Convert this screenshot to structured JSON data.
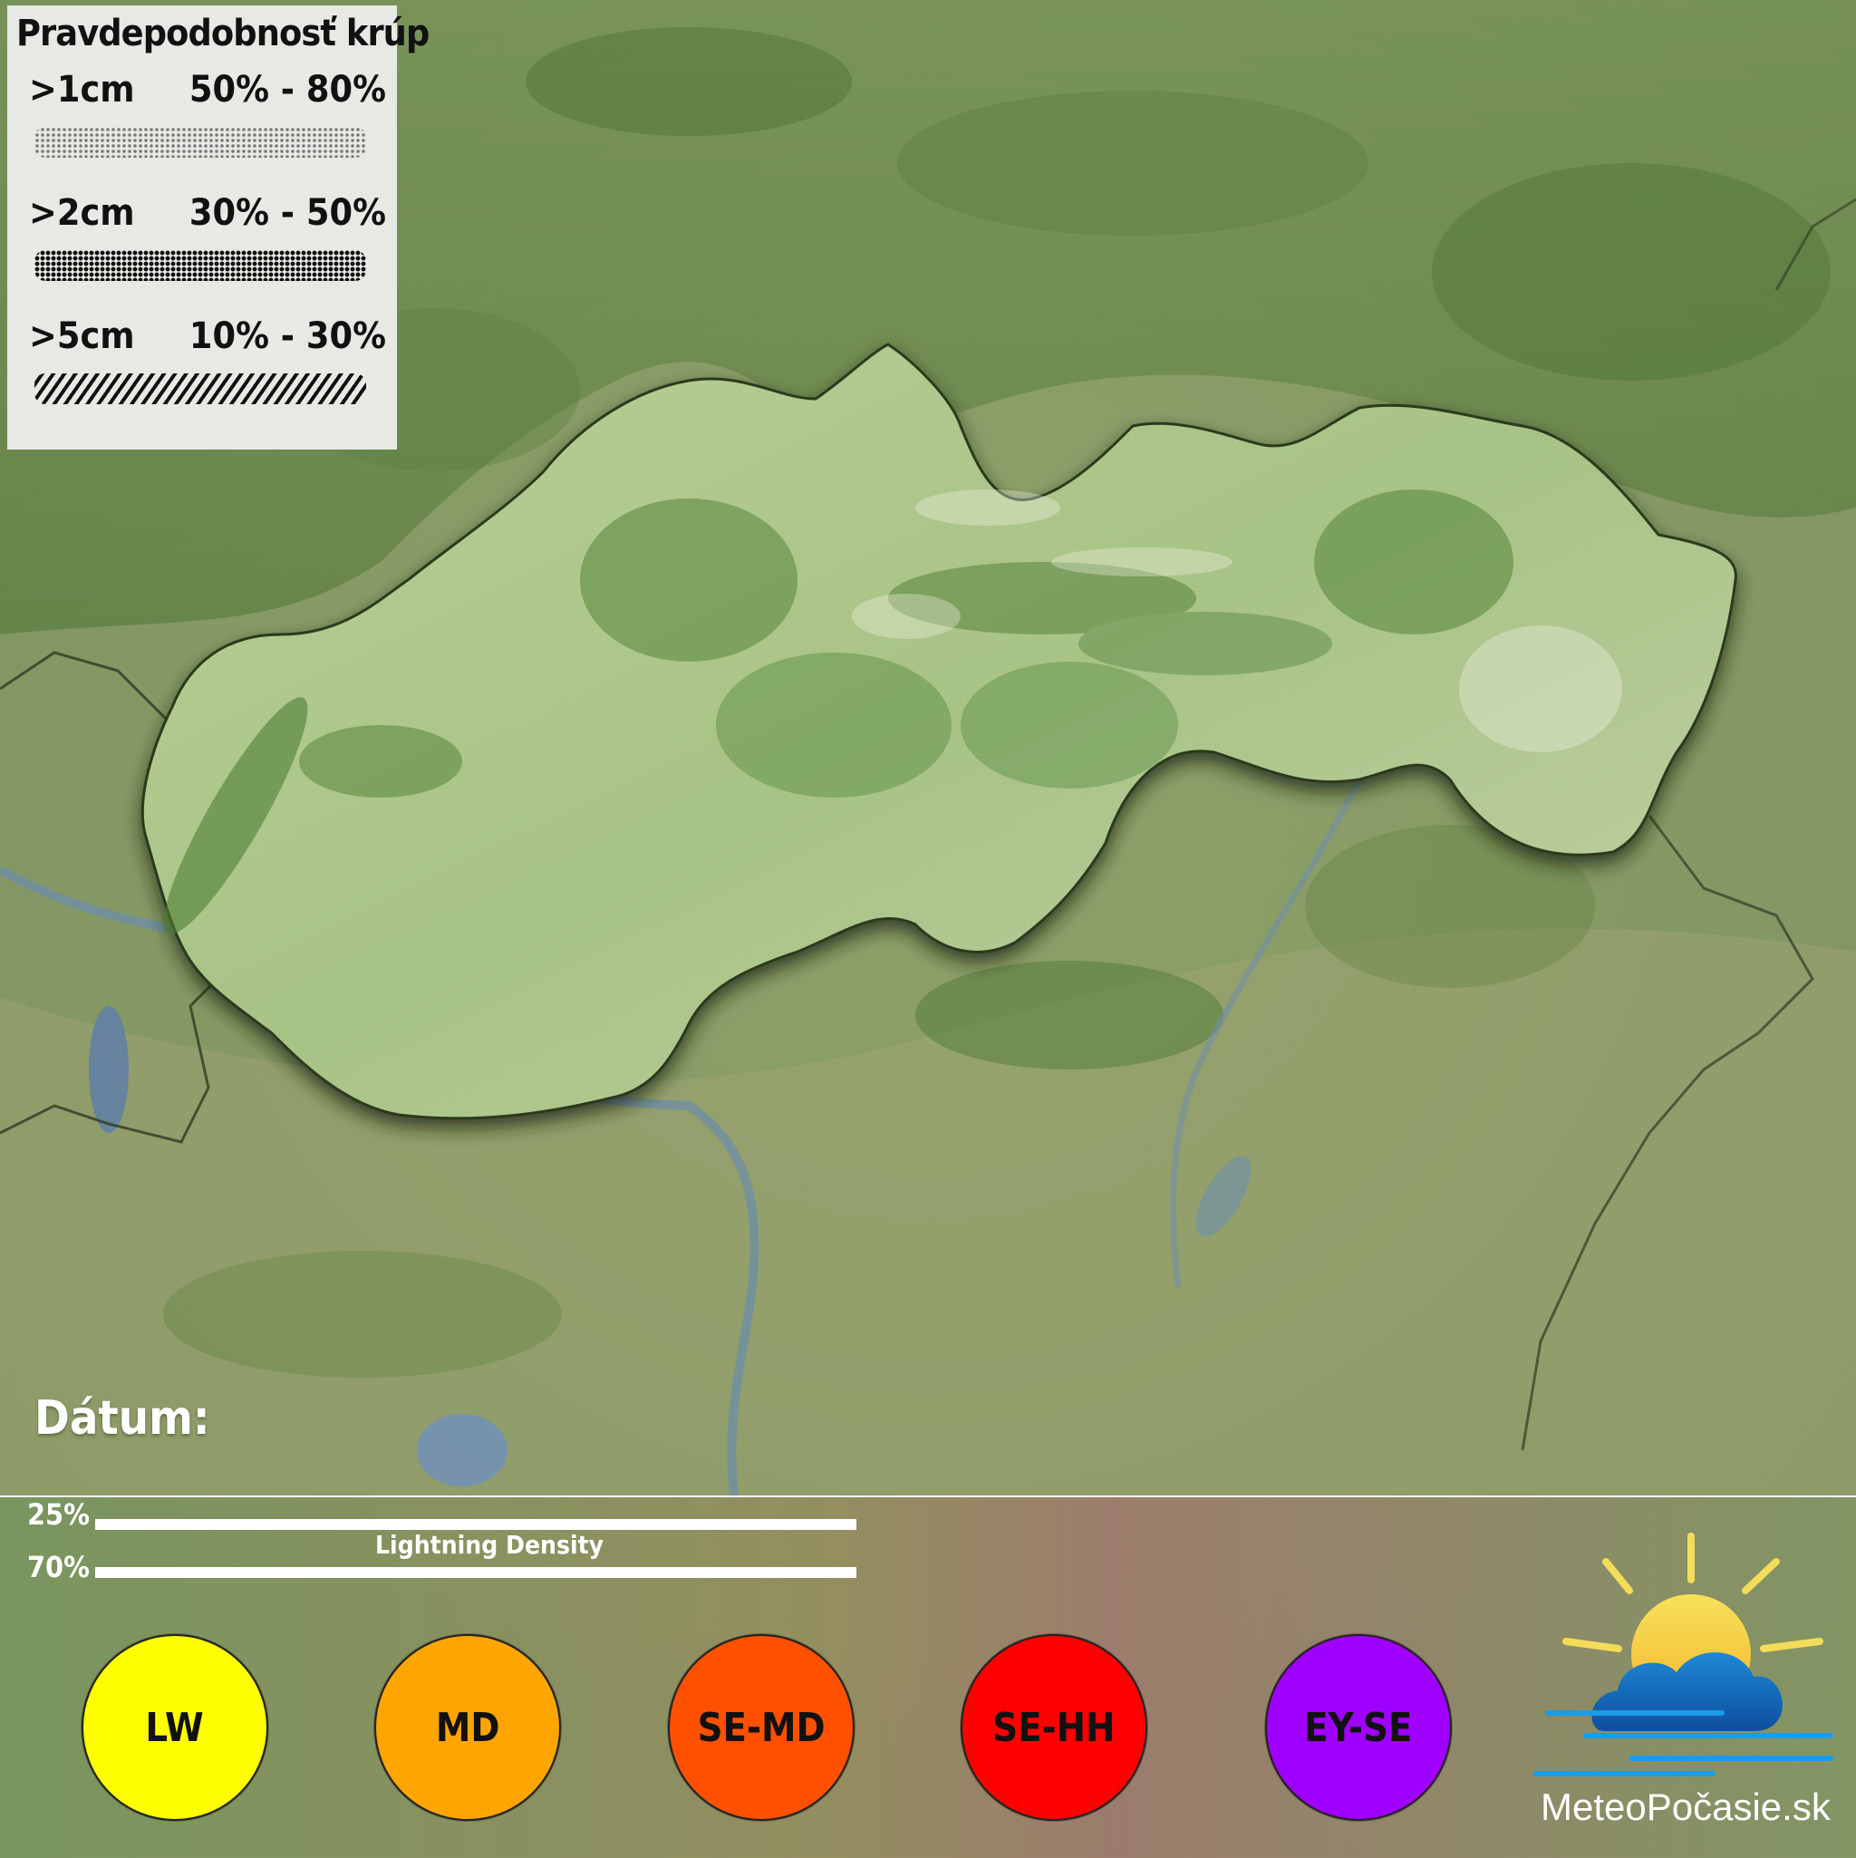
{
  "legend": {
    "title": "Pravdepodobnosť krúp",
    "rows": [
      {
        "size": ">1cm",
        "range": "50% - 80%",
        "pattern": "fine-dots"
      },
      {
        "size": ">2cm",
        "range": "30% - 50%",
        "pattern": "dense-dots"
      },
      {
        "size": ">5cm",
        "range": "10% - 30%",
        "pattern": "diagonal-hatch"
      }
    ]
  },
  "date_label": "Dátum:",
  "lightning": {
    "label": "Lightning Density",
    "thresholds": [
      "25%",
      "70%"
    ]
  },
  "levels": [
    {
      "code": "LW",
      "color": "#ffff00"
    },
    {
      "code": "MD",
      "color": "#ffa500"
    },
    {
      "code": "SE-MD",
      "color": "#ff5000"
    },
    {
      "code": "SE-HH",
      "color": "#ff0000"
    },
    {
      "code": "EY-SE",
      "color": "#a000ff"
    }
  ],
  "brand": {
    "name": "MeteoPočasie.sk",
    "logo_icon": "sun-cloud-icon"
  }
}
